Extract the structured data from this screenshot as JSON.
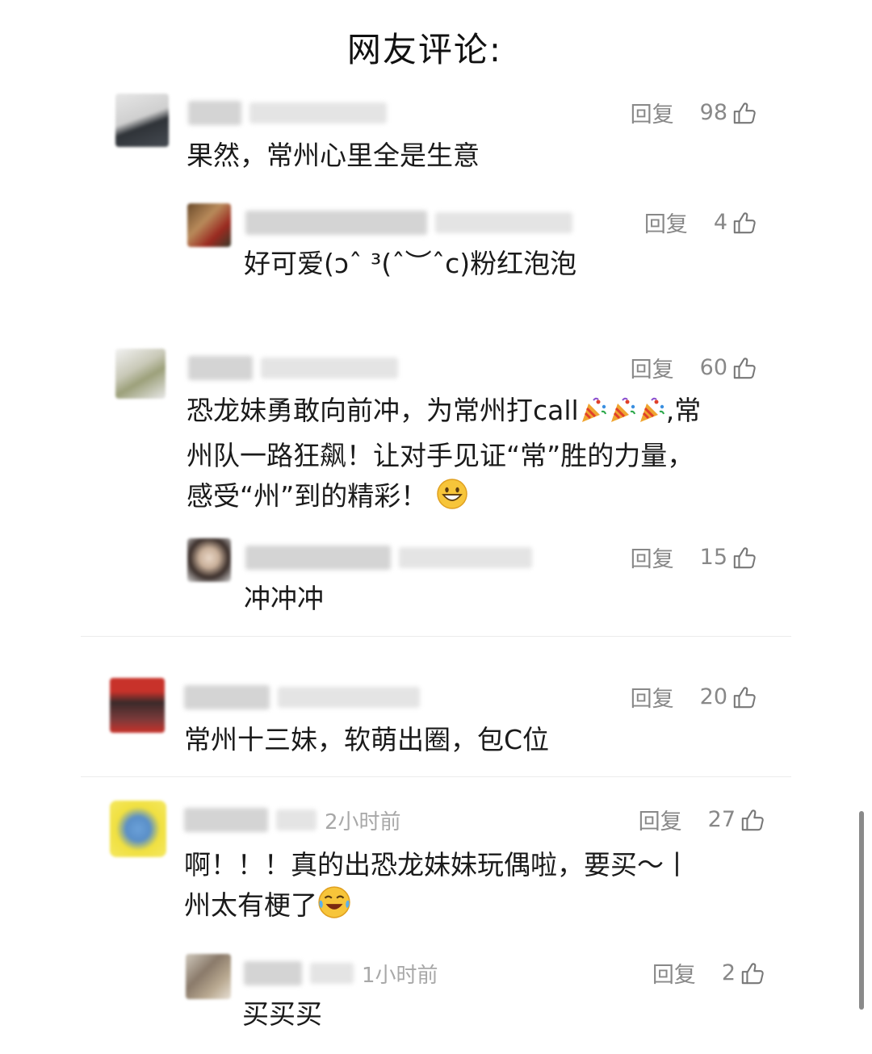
{
  "title": "网友评论:",
  "reply_label": "回复",
  "comments": [
    {
      "text": "果然，常州心里全是生意",
      "likes": "98",
      "replies": [
        {
          "text": "好可爱(ɔˆ ³(ˆ︶ˆc)粉红泡泡",
          "likes": "4"
        }
      ]
    },
    {
      "text_lines": [
        "恐龙妹勇敢向前冲，为常州打call",
        ",常",
        "州队一路狂飙！让对手见证“常”胜的力量，",
        "感受“州”到的精彩！"
      ],
      "likes": "60",
      "replies": [
        {
          "text": "冲冲冲",
          "likes": "15"
        }
      ]
    },
    {
      "text": "常州十三妹，软萌出圈，包C位",
      "likes": "20",
      "replies": []
    },
    {
      "text_lines": [
        "啊！！！真的出恐龙妹妹玩偶啦，要买～丨",
        "州太有梗了"
      ],
      "time": "2小时前",
      "likes": "27",
      "replies": [
        {
          "text": "买买买",
          "time": "1小时前",
          "likes": "2"
        }
      ]
    }
  ],
  "icons": {
    "like": "thumbs-up-icon",
    "party": "party-popper-icon",
    "grin": "grinning-face-icon",
    "laugh": "tears-of-joy-icon"
  }
}
